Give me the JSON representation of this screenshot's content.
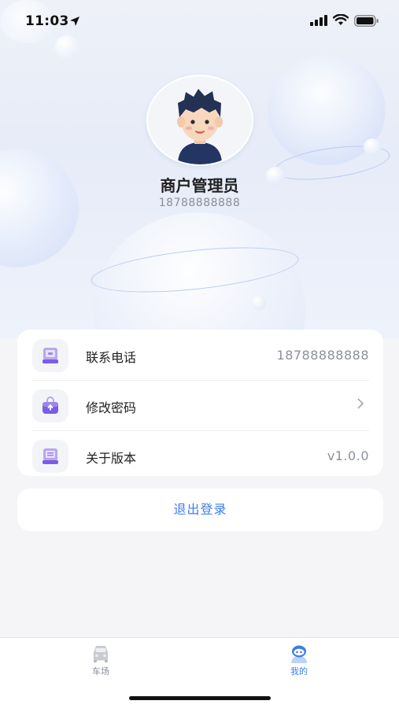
{
  "status_bar": {
    "time": "11:03",
    "location_icon": "location-arrow-icon",
    "signal_icon": "cellular-signal-icon",
    "wifi_icon": "wifi-icon",
    "battery_icon": "battery-icon"
  },
  "profile": {
    "avatar_icon": "user-avatar",
    "name": "商户管理员",
    "phone": "18788888888"
  },
  "menu": {
    "items": [
      {
        "icon": "phone-device-icon",
        "label": "联系电话",
        "value": "18788888888"
      },
      {
        "icon": "lock-bag-icon",
        "label": "修改密码",
        "value": ""
      },
      {
        "icon": "version-device-icon",
        "label": "关于版本",
        "value": "v1.0.0"
      }
    ]
  },
  "logout": {
    "label": "退出登录"
  },
  "tab_bar": {
    "tabs": [
      {
        "icon": "car-icon",
        "label": "车场",
        "active": false
      },
      {
        "icon": "robot-user-icon",
        "label": "我的",
        "active": true
      }
    ]
  },
  "colors": {
    "accent": "#3c7ef0",
    "background": "#f5f5f7",
    "card": "#ffffff",
    "muted_text": "#8a8f99",
    "icon_purple": "#7b5ce6"
  }
}
